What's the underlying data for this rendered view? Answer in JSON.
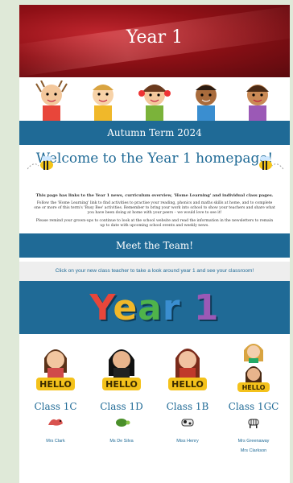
{
  "header": {
    "title": "Year 1"
  },
  "term_banner": {
    "label": "Autumn Term 2024"
  },
  "welcome": {
    "heading": "Welcome to the Year 1 homepage!",
    "intro_bold": "This page has links to the Year 1 news, curriculum overview, 'Home Learning' and individual class pages.",
    "intro_1": "Follow the 'Home Learning' link to find activities to practise your reading, phonics and maths skills at home, and to complete one or more of this term's 'Busy Bee' activities. Remember to bring your work into school to show your teachers and share what you have been doing at home with your peers – we would love to see it!",
    "intro_2": "Please remind your grown-ups to continue to look at the school website and read the information in the newsletters to remain up to date with upcoming school events and weekly news."
  },
  "team": {
    "heading": "Meet the Team!",
    "instruction": "Click on your new class teacher to take a look around year 1 and see your classroom!"
  },
  "year_banner": {
    "text": "Year 1"
  },
  "classes": [
    {
      "name": "Class 1C",
      "teacher": "Mrs Clark",
      "mascot": "dragon-icon"
    },
    {
      "name": "Class 1D",
      "teacher": "Ms De Silva",
      "mascot": "turtle-icon"
    },
    {
      "name": "Class 1B",
      "teacher": "Miss Henry",
      "mascot": "cow-icon"
    },
    {
      "name": "Class 1GC",
      "teacher": "Mrs Greenaway",
      "teacher2": "Mrs Clarkson",
      "mascot": "zebra-icon"
    }
  ],
  "colors": {
    "brand_blue": "#1f6a96",
    "hero_red": "#8f1016"
  }
}
